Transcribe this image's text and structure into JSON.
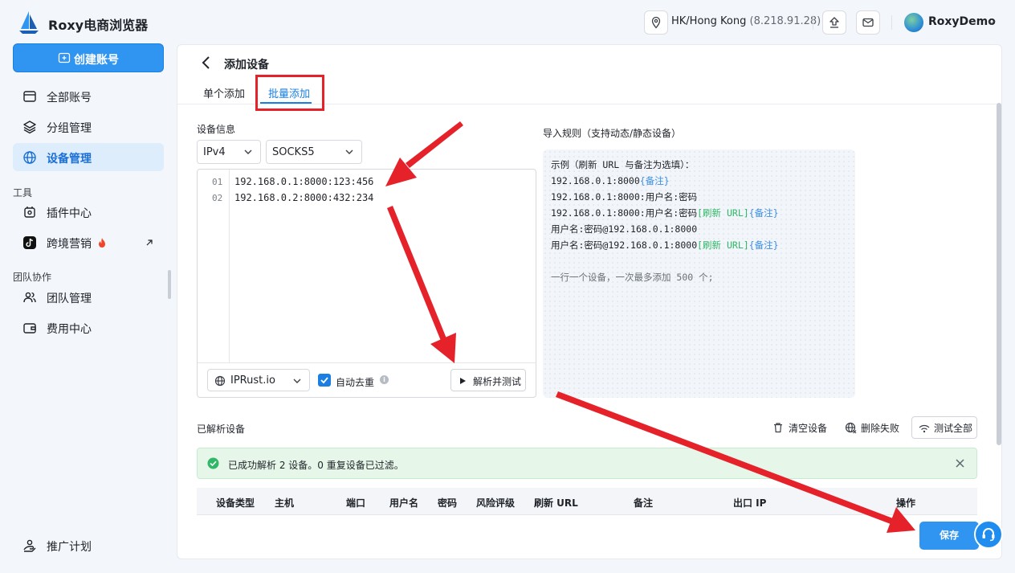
{
  "app": {
    "title": "Roxy电商浏览器"
  },
  "topbar": {
    "location": "HK/Hong Kong",
    "ip": "(8.218.91.28)",
    "user": "RoxyDemo"
  },
  "sidebar": {
    "create_button": "创建账号",
    "items_main": [
      {
        "label": "全部账号",
        "icon": "window-icon"
      },
      {
        "label": "分组管理",
        "icon": "layers-icon"
      },
      {
        "label": "设备管理",
        "icon": "globe-icon",
        "active": true
      }
    ],
    "section_tools": "工具",
    "items_tools": [
      {
        "label": "插件中心",
        "icon": "plugin-icon"
      },
      {
        "label": "跨境营销",
        "icon": "tiktok-icon",
        "badge": "fire-icon",
        "external": true
      }
    ],
    "section_team": "团队协作",
    "items_team": [
      {
        "label": "团队管理",
        "icon": "team-icon"
      },
      {
        "label": "费用中心",
        "icon": "wallet-icon"
      }
    ],
    "footer_item": "推广计划"
  },
  "page": {
    "title": "添加设备",
    "tabs": [
      "单个添加",
      "批量添加"
    ],
    "active_tab": 1
  },
  "device_info": {
    "label": "设备信息",
    "ip_version": "IPv4",
    "protocol": "SOCKS5",
    "line_numbers": [
      "01",
      "02"
    ],
    "lines": [
      "192.168.0.1:8000:123:456",
      "192.168.0.2:8000:432:234"
    ],
    "checker": "IPRust.io",
    "dedupe_label": "自动去重",
    "dedupe_checked": true,
    "parse_button": "解析并测试"
  },
  "rules": {
    "title": "导入规则（支持动态/静态设备）",
    "intro": "示例（刷新 URL 与备注为选填）：",
    "r1": "192.168.0.1:8000",
    "r1_note": "{备注}",
    "r2": "192.168.0.1:8000:用户名:密码",
    "r3": "192.168.0.1:8000:用户名:密码",
    "r3_refresh": "[刷新 URL]",
    "r3_note": "{备注}",
    "r4": "用户名:密码@192.168.0.1:8000",
    "r5": "用户名:密码@192.168.0.1:8000",
    "r5_refresh": "[刷新 URL]",
    "r5_note": "{备注}",
    "hint": "一行一个设备，一次最多添加 500 个;"
  },
  "parsed": {
    "title": "已解析设备",
    "clear": "清空设备",
    "delete_failed": "删除失败",
    "test_all": "测试全部",
    "alert": "已成功解析 2 设备。0 重复设备已过滤。",
    "columns": [
      "设备类型",
      "主机",
      "端口",
      "用户名",
      "密码",
      "风险评级",
      "刷新 URL",
      "备注",
      "出口 IP",
      "操作"
    ]
  },
  "footer": {
    "save": "保存"
  },
  "colors": {
    "accent": "#2f95f0",
    "annotation": "#e5222a",
    "success": "#2fb866"
  }
}
